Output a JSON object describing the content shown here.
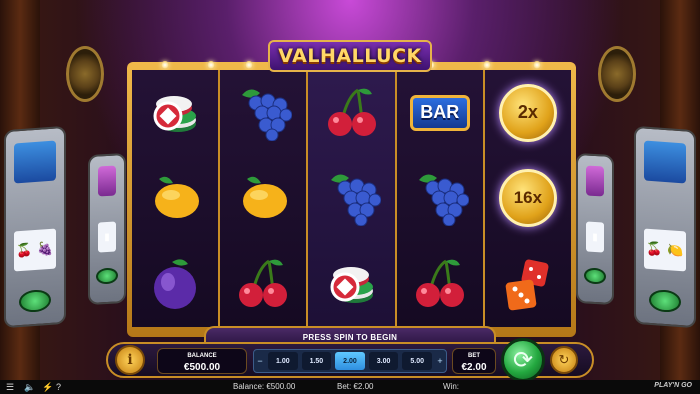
{
  "game": {
    "logo_text": "VALHALLUCK",
    "message": "PRESS SPIN TO BEGIN"
  },
  "reels": [
    [
      "casino-chips",
      "lemon",
      "plum"
    ],
    [
      "grapes",
      "lemon",
      "cherries"
    ],
    [
      "cherries",
      "grapes",
      "casino-chips"
    ],
    [
      "bar",
      "grapes",
      "cherries"
    ],
    [
      "multiplier-2x",
      "multiplier-16x",
      "dice"
    ]
  ],
  "symbols": {
    "bar_label": "BAR",
    "multiplier_top": "2x",
    "multiplier_mid": "16x"
  },
  "controls": {
    "info_label": "i",
    "balance_label": "BALANCE",
    "balance_value": "€500.00",
    "bet_minus": "−",
    "bet_plus": "+",
    "bet_options": [
      "1.00",
      "1.50",
      "2.00",
      "3.00",
      "5.00"
    ],
    "bet_selected": "2.00",
    "bet_label": "BET",
    "bet_value": "€2.00"
  },
  "status_bar": {
    "balance": "Balance: €500.00",
    "bet": "Bet: €2.00",
    "win": "Win:",
    "brand": "PLAY'N GO"
  },
  "colors": {
    "frame_gold": "#e0a83a",
    "reel_bg": "#1a0d2a",
    "logo_purple": "#5a1f8f",
    "selected_bet": "#4fb6ff",
    "spin_green": "#23a83f"
  },
  "icons": [
    "menu-icon",
    "sound-icon",
    "turbo-icon",
    "help-icon"
  ]
}
